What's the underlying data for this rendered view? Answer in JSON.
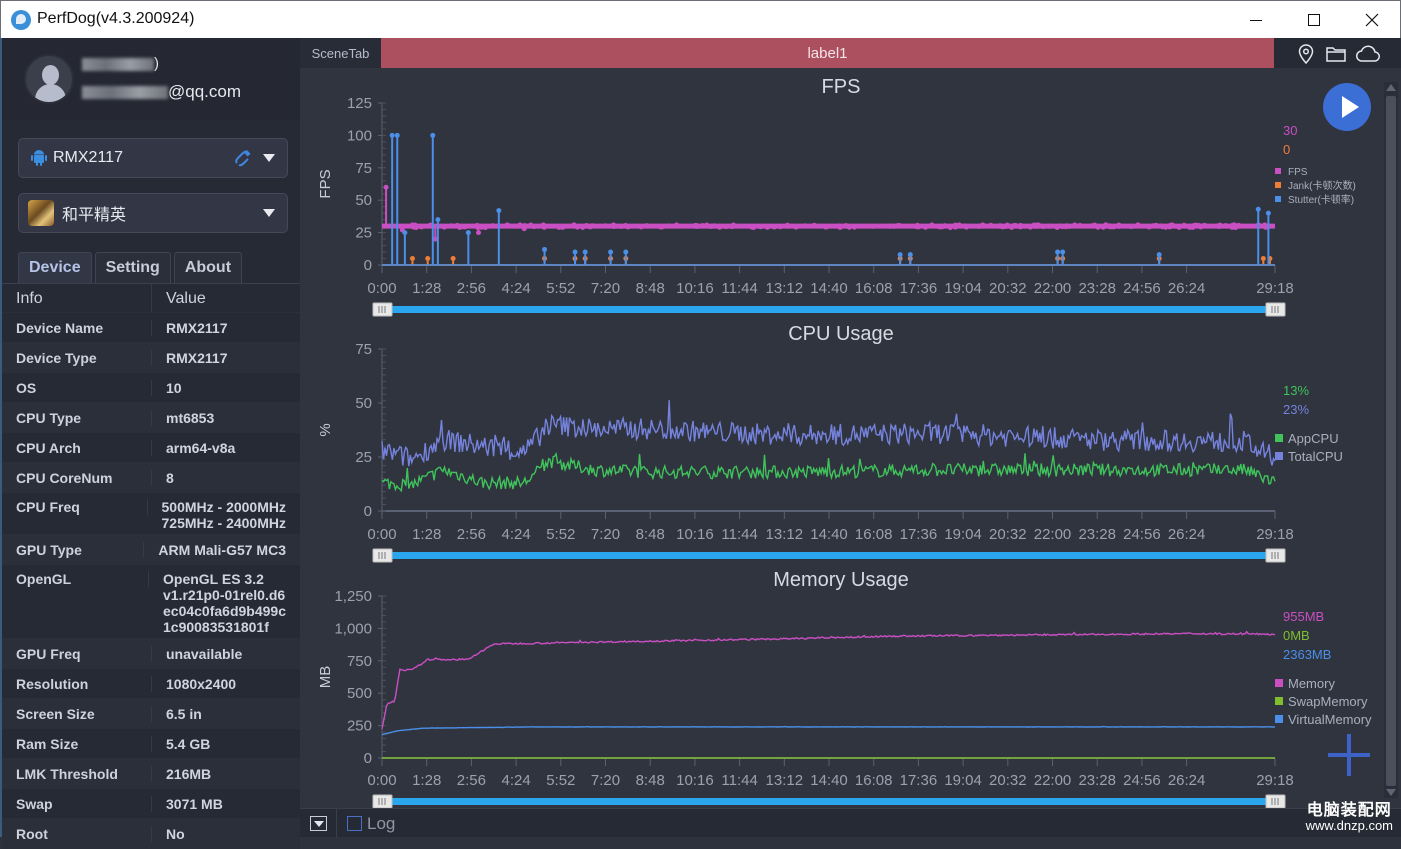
{
  "window": {
    "title": "PerfDog(v4.3.200924)",
    "minimize_icon": "minimize-icon",
    "maximize_icon": "maximize-icon",
    "close_icon": "close-icon"
  },
  "user": {
    "name_suffix": ")",
    "email_suffix": "@qq.com"
  },
  "device_select": {
    "value": "RMX2117",
    "icon": "android-icon",
    "connection_icon": "usb-cable-icon"
  },
  "app_select": {
    "value": "和平精英",
    "icon": "game-app-icon"
  },
  "tabs": [
    {
      "label": "Device",
      "active": true
    },
    {
      "label": "Setting",
      "active": false
    },
    {
      "label": "About",
      "active": false
    }
  ],
  "info_table": {
    "headers": [
      "Info",
      "Value"
    ],
    "rows": [
      {
        "key": "Device Name",
        "value": "RMX2117"
      },
      {
        "key": "Device Type",
        "value": "RMX2117"
      },
      {
        "key": "OS",
        "value": "10"
      },
      {
        "key": "CPU Type",
        "value": "mt6853"
      },
      {
        "key": "CPU Arch",
        "value": "arm64-v8a"
      },
      {
        "key": "CPU CoreNum",
        "value": "8"
      },
      {
        "key": "CPU Freq",
        "value": "500MHz - 2000MHz\n725MHz - 2400MHz"
      },
      {
        "key": "GPU Type",
        "value": "ARM Mali-G57 MC3"
      },
      {
        "key": "OpenGL",
        "value": "OpenGL ES 3.2\nv1.r21p0-01rel0.d6\nec04c0fa6d9b499c\n1c90083531801f"
      },
      {
        "key": "GPU Freq",
        "value": "unavailable"
      },
      {
        "key": "Resolution",
        "value": "1080x2400"
      },
      {
        "key": "Screen Size",
        "value": "6.5 in"
      },
      {
        "key": "Ram Size",
        "value": "5.4 GB"
      },
      {
        "key": "LMK Threshold",
        "value": "216MB"
      },
      {
        "key": "Swap",
        "value": "3071 MB"
      },
      {
        "key": "Root",
        "value": "No"
      }
    ]
  },
  "scene": {
    "tab_label": "SceneTab",
    "label": "label1",
    "label_color": "#ac4f5e"
  },
  "toolbar_icons": [
    "location-pin-icon",
    "folder-icon",
    "cloud-icon"
  ],
  "bottom": {
    "log_label": "Log",
    "log_checked": false
  },
  "watermark": {
    "line1": "电脑装配网",
    "line2": "www.dnzp.com"
  },
  "chart_data": [
    {
      "type": "line",
      "title": "FPS",
      "ylabel": "FPS",
      "ylim": [
        0,
        125
      ],
      "yticks": [
        "0",
        "25",
        "50",
        "75",
        "100",
        "125"
      ],
      "xticks": [
        "0:00",
        "1:28",
        "2:56",
        "4:24",
        "5:52",
        "7:20",
        "8:48",
        "10:16",
        "11:44",
        "13:12",
        "14:40",
        "16:08",
        "17:36",
        "19:04",
        "20:32",
        "22:00",
        "23:28",
        "24:56",
        "26:24",
        "29:18"
      ],
      "xlim_seconds": [
        0,
        1758
      ],
      "current_values": [
        {
          "text": "30",
          "color": "#c94fc2"
        },
        {
          "text": "0",
          "color": "#ee7d37"
        }
      ],
      "legend_position": "right",
      "series": [
        {
          "name": "FPS",
          "color": "#c94fc2",
          "baseline": 30,
          "spikes": [
            [
              8,
              60
            ],
            [
              40,
              27
            ],
            [
              105,
              20
            ],
            [
              190,
              25
            ],
            [
              280,
              28
            ]
          ]
        },
        {
          "name": "Jank(卡顿次数)",
          "color": "#ee7d37",
          "baseline": 0,
          "spikes": [
            [
              60,
              5
            ],
            [
              90,
              5
            ],
            [
              140,
              5
            ],
            [
              320,
              5
            ],
            [
              380,
              5
            ],
            [
              400,
              5
            ],
            [
              450,
              5
            ],
            [
              480,
              5
            ],
            [
              1020,
              5
            ],
            [
              1040,
              5
            ],
            [
              1330,
              5
            ],
            [
              1340,
              5
            ],
            [
              1530,
              5
            ],
            [
              1735,
              5
            ],
            [
              1748,
              5
            ]
          ]
        },
        {
          "name": "Stutter(卡顿率)",
          "color": "#4b8fe8",
          "baseline": 0,
          "spikes": [
            [
              20,
              100
            ],
            [
              30,
              100
            ],
            [
              45,
              25
            ],
            [
              100,
              100
            ],
            [
              110,
              35
            ],
            [
              170,
              25
            ],
            [
              230,
              42
            ],
            [
              320,
              12
            ],
            [
              380,
              10
            ],
            [
              400,
              10
            ],
            [
              450,
              10
            ],
            [
              480,
              10
            ],
            [
              1020,
              8
            ],
            [
              1040,
              8
            ],
            [
              1330,
              10
            ],
            [
              1340,
              10
            ],
            [
              1530,
              8
            ],
            [
              1725,
              43
            ],
            [
              1745,
              40
            ]
          ]
        }
      ]
    },
    {
      "type": "line",
      "title": "CPU Usage",
      "ylabel": "%",
      "ylim": [
        0,
        75
      ],
      "yticks": [
        "0",
        "25",
        "50",
        "75"
      ],
      "xticks": [
        "0:00",
        "1:28",
        "2:56",
        "4:24",
        "5:52",
        "7:20",
        "8:48",
        "10:16",
        "11:44",
        "13:12",
        "14:40",
        "16:08",
        "17:36",
        "19:04",
        "20:32",
        "22:00",
        "23:28",
        "24:56",
        "26:24",
        "29:18"
      ],
      "xlim_seconds": [
        0,
        1758
      ],
      "current_values": [
        {
          "text": "13%",
          "color": "#3fc35a"
        },
        {
          "text": "23%",
          "color": "#7583dd"
        }
      ],
      "legend_position": "right",
      "series": [
        {
          "name": "AppCPU",
          "color": "#3fc35a",
          "profile": [
            [
              0,
              13
            ],
            [
              60,
              12
            ],
            [
              120,
              19
            ],
            [
              200,
              13
            ],
            [
              280,
              13
            ],
            [
              330,
              23
            ],
            [
              420,
              19
            ],
            [
              520,
              18
            ],
            [
              800,
              18
            ],
            [
              1100,
              19
            ],
            [
              1400,
              19
            ],
            [
              1700,
              19
            ],
            [
              1758,
              13
            ]
          ],
          "noise": 3
        },
        {
          "name": "TotalCPU",
          "color": "#7583dd",
          "profile": [
            [
              0,
              28
            ],
            [
              60,
              24
            ],
            [
              120,
              33
            ],
            [
              200,
              30
            ],
            [
              280,
              27
            ],
            [
              330,
              40
            ],
            [
              420,
              38
            ],
            [
              520,
              38
            ],
            [
              800,
              35
            ],
            [
              1100,
              36
            ],
            [
              1400,
              33
            ],
            [
              1700,
              32
            ],
            [
              1758,
              23
            ]
          ],
          "noise": 5
        }
      ]
    },
    {
      "type": "line",
      "title": "Memory Usage",
      "ylabel": "MB",
      "ylim": [
        0,
        1250
      ],
      "yticks": [
        "0",
        "250",
        "500",
        "750",
        "1,000",
        "1,250"
      ],
      "xticks": [
        "0:00",
        "1:28",
        "2:56",
        "4:24",
        "5:52",
        "7:20",
        "8:48",
        "10:16",
        "11:44",
        "13:12",
        "14:40",
        "16:08",
        "17:36",
        "19:04",
        "20:32",
        "22:00",
        "23:28",
        "24:56",
        "26:24",
        "29:18"
      ],
      "xlim_seconds": [
        0,
        1758
      ],
      "current_values": [
        {
          "text": "955MB",
          "color": "#c94fc2"
        },
        {
          "text": "0MB",
          "color": "#7fbf2e"
        },
        {
          "text": "2363MB",
          "color": "#4b8fe8"
        }
      ],
      "legend_position": "right",
      "series": [
        {
          "name": "Memory",
          "color": "#c94fc2",
          "profile": [
            [
              0,
              220
            ],
            [
              10,
              420
            ],
            [
              25,
              440
            ],
            [
              35,
              680
            ],
            [
              60,
              680
            ],
            [
              90,
              760
            ],
            [
              170,
              760
            ],
            [
              220,
              880
            ],
            [
              500,
              900
            ],
            [
              800,
              920
            ],
            [
              1000,
              940
            ],
            [
              1300,
              950
            ],
            [
              1600,
              960
            ],
            [
              1758,
              955
            ]
          ],
          "noise": 6
        },
        {
          "name": "SwapMemory",
          "color": "#7fbf2e",
          "profile": [
            [
              0,
              0
            ],
            [
              1758,
              0
            ]
          ],
          "noise": 0
        },
        {
          "name": "VirtualMemory",
          "color": "#4b8fe8",
          "profile": [
            [
              0,
              180
            ],
            [
              30,
              210
            ],
            [
              80,
              230
            ],
            [
              300,
              240
            ],
            [
              1758,
              240
            ]
          ],
          "noise": 1
        }
      ]
    }
  ]
}
